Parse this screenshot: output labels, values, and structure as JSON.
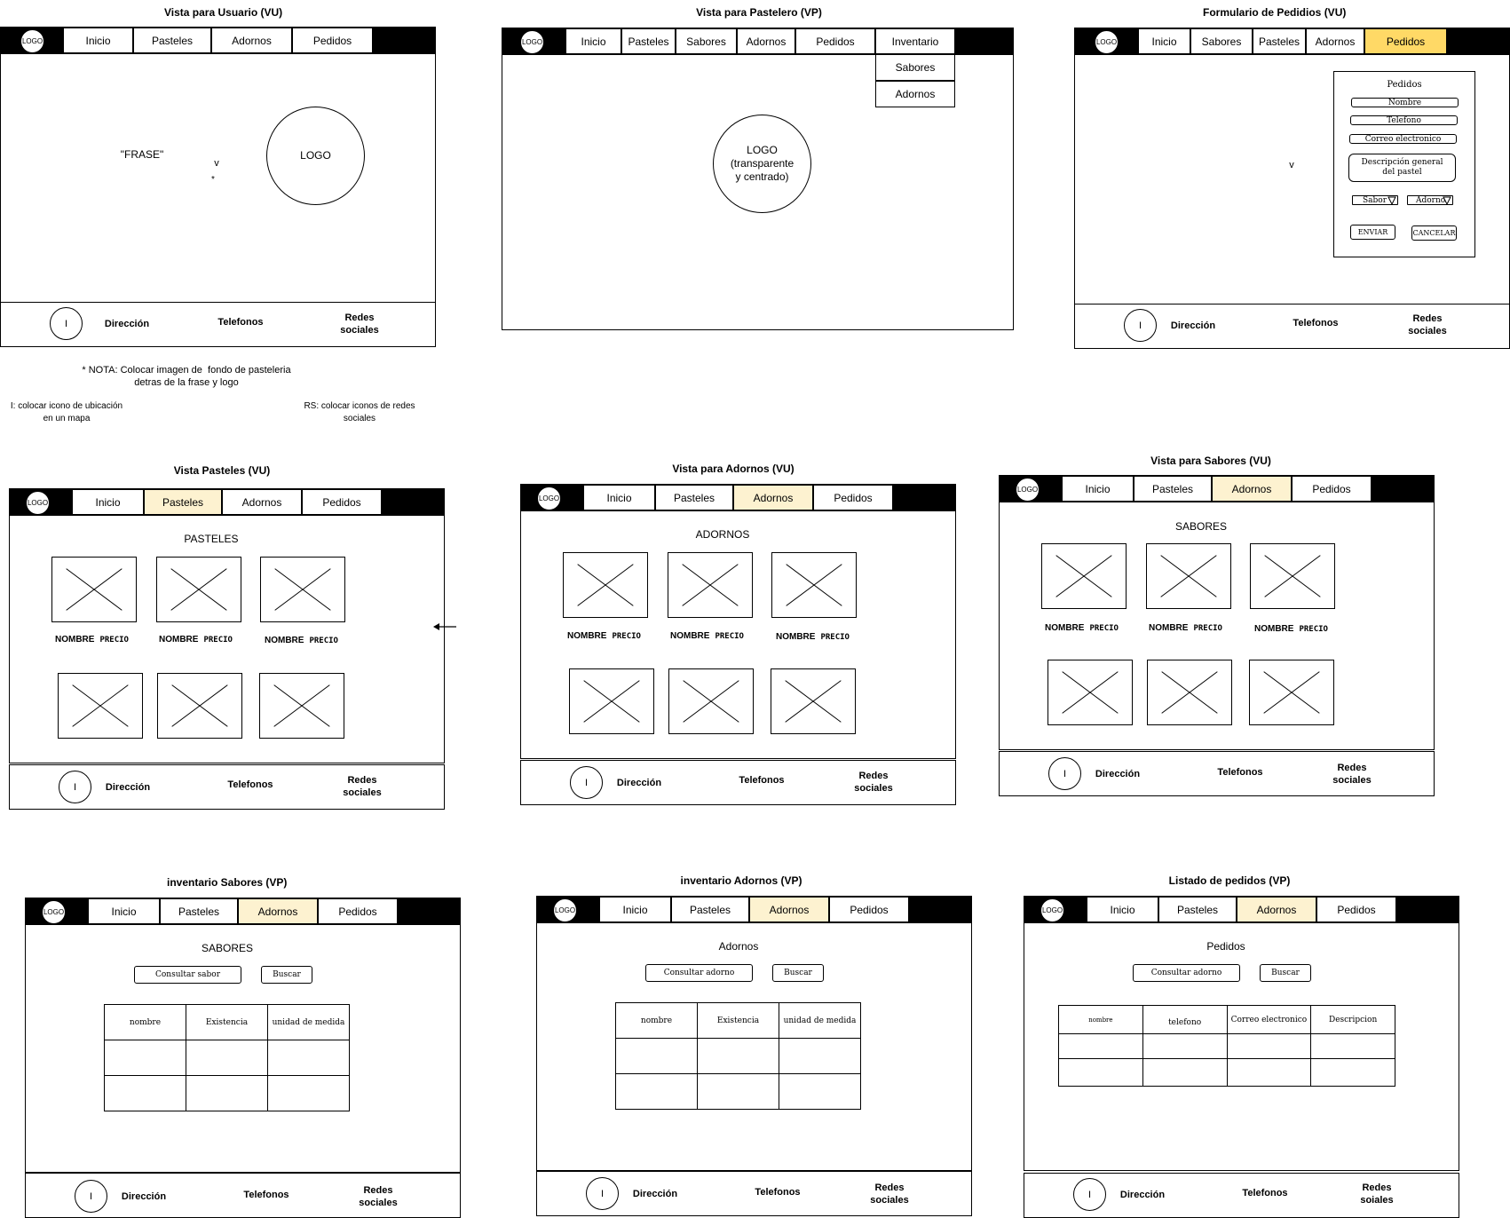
{
  "common": {
    "logo_small": "LOGO",
    "footer": {
      "icon": "I",
      "address": "Dirección",
      "phones": "Telefonos",
      "social": "Redes\nsociales"
    },
    "product_name": "NOMBRE",
    "product_price": "PRECIO"
  },
  "mockups": {
    "vu_home": {
      "title": "Vista para Usuario (VU)",
      "nav": [
        "Inicio",
        "Pasteles",
        "Adornos",
        "Pedidos"
      ],
      "phrase": "\"FRASE\"",
      "v_mark": "v",
      "asterisk": "*",
      "logo_big": "LOGO"
    },
    "vp_home": {
      "title": "Vista para Pastelero (VP)",
      "nav": [
        "Inicio",
        "Pasteles",
        "Sabores",
        "Adornos",
        "Pedidos",
        "Inventario"
      ],
      "dropdown": [
        "Sabores",
        "Adornos"
      ],
      "logo_big": "LOGO\n(transparente\ny centrado)"
    },
    "order_form": {
      "title": "Formulario de Pedidios (VU)",
      "nav": [
        "Inicio",
        "Sabores",
        "Pasteles",
        "Adornos",
        "Pedidos"
      ],
      "v_mark": "v",
      "form_title": "Pedidos",
      "fields": [
        "Nombre",
        "Telefono",
        "Correo electronico"
      ],
      "description": "Descripción general del pastel",
      "select_flavor": "Sabor",
      "select_decor": "Adorno",
      "submit": "ENVIAR",
      "cancel": "CANCELAR"
    },
    "cakes": {
      "title": "Vista Pasteles (VU)",
      "nav": [
        "Inicio",
        "Pasteles",
        "Adornos",
        "Pedidos"
      ],
      "heading": "PASTELES"
    },
    "decor": {
      "title": "Vista para Adornos (VU)",
      "nav": [
        "Inicio",
        "Pasteles",
        "Adornos",
        "Pedidos"
      ],
      "heading": "ADORNOS"
    },
    "flavors": {
      "title": "Vista para Sabores (VU)",
      "nav": [
        "Inicio",
        "Pasteles",
        "Adornos",
        "Pedidos"
      ],
      "heading": "SABORES"
    },
    "inv_flavors": {
      "title": "inventario Sabores (VP)",
      "nav": [
        "Inicio",
        "Pasteles",
        "Adornos",
        "Pedidos"
      ],
      "heading": "SABORES",
      "query_button": "Consultar sabor",
      "search_button": "Buscar",
      "columns": [
        "nombre",
        "Existencia",
        "unidad de medida"
      ]
    },
    "inv_decor": {
      "title": "inventario Adornos (VP)",
      "nav": [
        "Inicio",
        "Pasteles",
        "Adornos",
        "Pedidos"
      ],
      "heading": "Adornos",
      "query_button": "Consultar adorno",
      "search_button": "Buscar",
      "columns": [
        "nombre",
        "Existencia",
        "unidad de medida"
      ]
    },
    "orders_list": {
      "title": "Listado de pedidos (VP)",
      "nav": [
        "Inicio",
        "Pasteles",
        "Adornos",
        "Pedidos"
      ],
      "heading": "Pedidos",
      "query_button": "Consultar adorno",
      "search_button": "Buscar",
      "columns": [
        "nombre",
        "telefono",
        "Correo electronico",
        "Descripcion"
      ]
    }
  },
  "notes": {
    "background": "* NOTA: Colocar imagen de  fondo de pasteleria\ndetras de la frase y logo",
    "location": "I: colocar icono de ubicación\nen un mapa",
    "social": "RS: colocar iconos de redes\nsociales",
    "social_footer": "Redes\nsoiales"
  },
  "colors": {
    "highlight_light": "#fdf2d0",
    "highlight_active": "#ffd966"
  }
}
